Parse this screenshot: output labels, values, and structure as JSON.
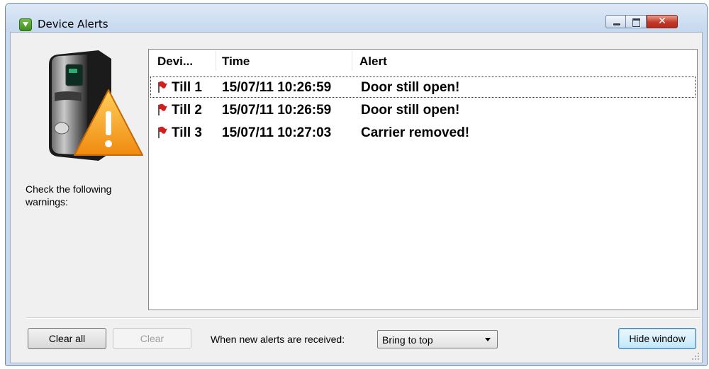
{
  "window": {
    "title": "Device Alerts",
    "controls": [
      "minimize",
      "maximize",
      "close"
    ]
  },
  "sidebar": {
    "message": "Check the following warnings:"
  },
  "alerts_table": {
    "columns": [
      "Devi...",
      "Time",
      "Alert"
    ],
    "rows": [
      {
        "device": "Till 1",
        "time": "15/07/11 10:26:59",
        "alert": "Door still open!",
        "icon": "red-flag-icon",
        "focused": true
      },
      {
        "device": "Till 2",
        "time": "15/07/11 10:26:59",
        "alert": "Door still open!",
        "icon": "red-flag-icon",
        "focused": false
      },
      {
        "device": "Till 3",
        "time": "15/07/11 10:27:03",
        "alert": "Carrier removed!",
        "icon": "red-flag-icon",
        "focused": false
      }
    ]
  },
  "footer": {
    "clear_all_label": "Clear all",
    "clear_label": "Clear",
    "clear_enabled": false,
    "when_label": "When new alerts are received:",
    "when_value": "Bring to top",
    "hide_label": "Hide window"
  },
  "colors": {
    "flag": "#d11f1f",
    "warning": "#f39a1b"
  }
}
